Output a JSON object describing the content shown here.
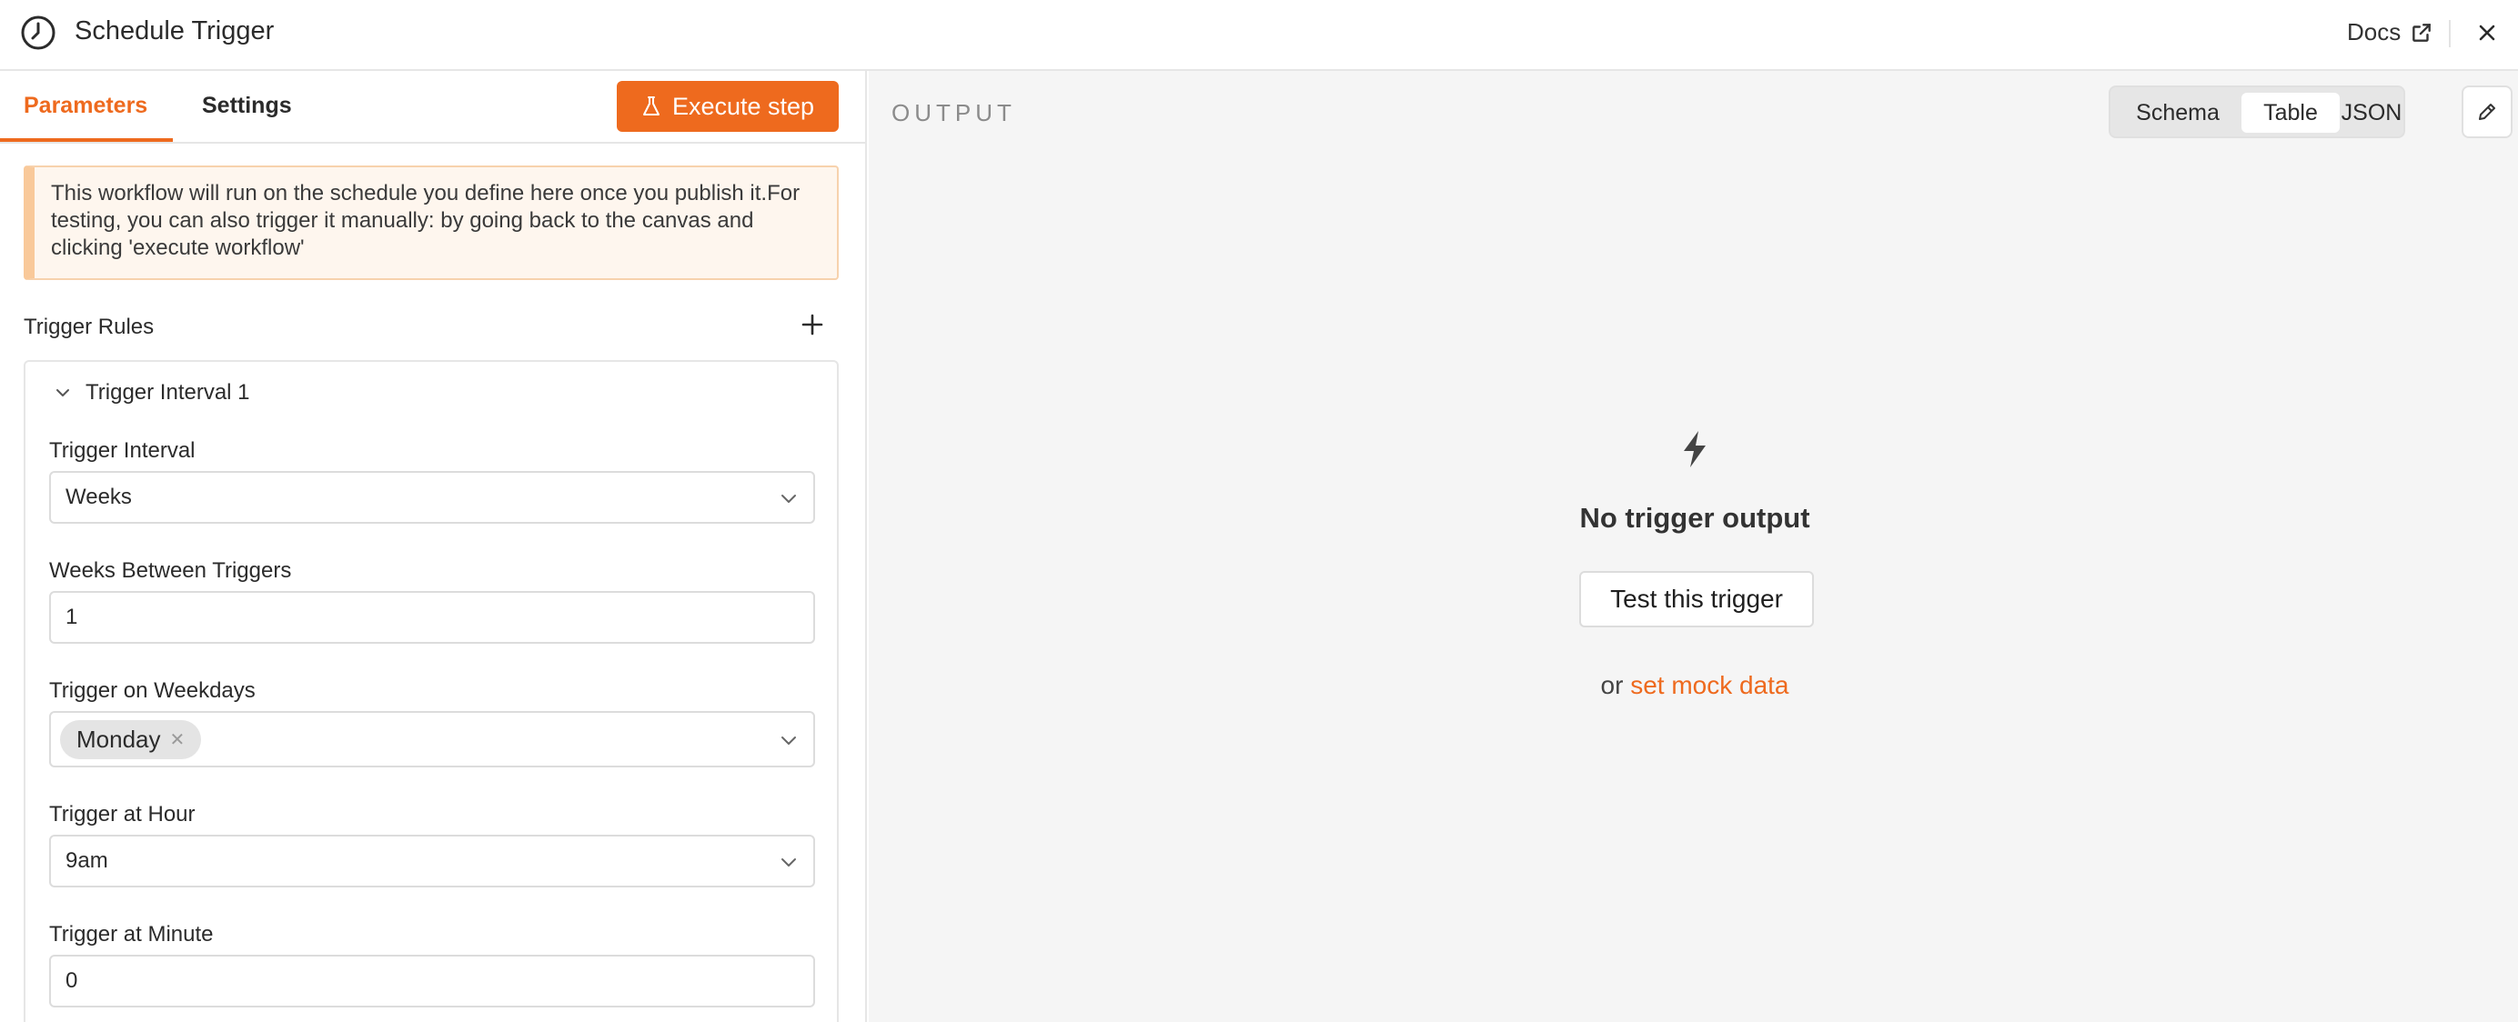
{
  "header": {
    "title": "Schedule Trigger",
    "docs_label": "Docs",
    "icon": "clock-icon"
  },
  "tabs": {
    "parameters": "Parameters",
    "settings": "Settings",
    "active": "Parameters"
  },
  "execute_button": "Execute step",
  "notice": "This workflow will run on the schedule you define here once you publish it.For testing, you can also trigger it manually: by going back to the canvas and clicking 'execute workflow'",
  "trigger_rules": {
    "label": "Trigger Rules",
    "interval_title": "Trigger Interval 1",
    "fields": {
      "interval": {
        "label": "Trigger Interval",
        "value": "Weeks"
      },
      "weeks_between": {
        "label": "Weeks Between Triggers",
        "value": "1"
      },
      "weekdays": {
        "label": "Trigger on Weekdays",
        "chip": "Monday"
      },
      "hour": {
        "label": "Trigger at Hour",
        "value": "9am"
      },
      "minute": {
        "label": "Trigger at Minute",
        "value": "0"
      }
    }
  },
  "output": {
    "label": "OUTPUT",
    "views": [
      "Schema",
      "Table",
      "JSON"
    ],
    "active_view": "Table",
    "empty_title": "No trigger output",
    "test_button": "Test this trigger",
    "or_text": "or",
    "mock_link": "set mock data"
  },
  "colors": {
    "accent": "#ee6a1e",
    "notice_bg": "#fef6ee",
    "notice_border": "#f9c99a",
    "output_bg": "#f5f5f5"
  }
}
